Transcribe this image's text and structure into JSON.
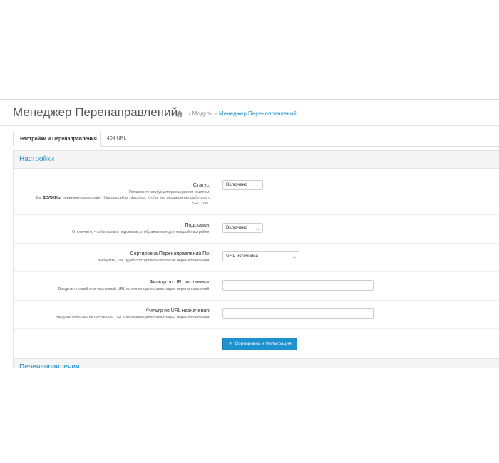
{
  "header": {
    "title": "Менеджер Перенаправлений",
    "breadcrumb": [
      "Модули",
      "Менеджер Перенаправлений"
    ]
  },
  "tabs": [
    "Настройки и Перенаправления",
    "404 URL"
  ],
  "settings": {
    "heading": "Настройки",
    "status": {
      "label": "Статус:",
      "help1": "Установите статус для расширения в целом.",
      "help2_pre": "Вы ",
      "help2_bold": "ДОЛЖНЫ",
      "help2_post": " переименовать файл .htaccess.txt в .htaccess, чтобы это расширение работало с",
      "help3": "SEO URL.",
      "value": "Включено"
    },
    "tips": {
      "label": "Подсказки:",
      "help": "Отключите, чтобы скрыть подсказки, отображаемые для каждой настройки.",
      "value": "Включено"
    },
    "sort": {
      "label": "Сортировка Перенаправлений По:",
      "help": "Выберите, как будет сортироваться список перенаправлений.",
      "value": "URL источника"
    },
    "source_filter": {
      "label": "Фильтр по URL источника:",
      "help": "Введите полный или частичный URL источника для фильтрации перенаправлений.",
      "value": ""
    },
    "dest_filter": {
      "label": "Фильтр по URL назначения:",
      "help": "Введите полный или частичный URL назначения для фильтрации перенаправлений.",
      "value": ""
    },
    "button": "Сортировка и Фильтрация"
  },
  "redirects": {
    "heading": "Перенаправления"
  },
  "colors": {
    "accent": "#1e91cf",
    "panel_bg": "#f5f5f5"
  }
}
